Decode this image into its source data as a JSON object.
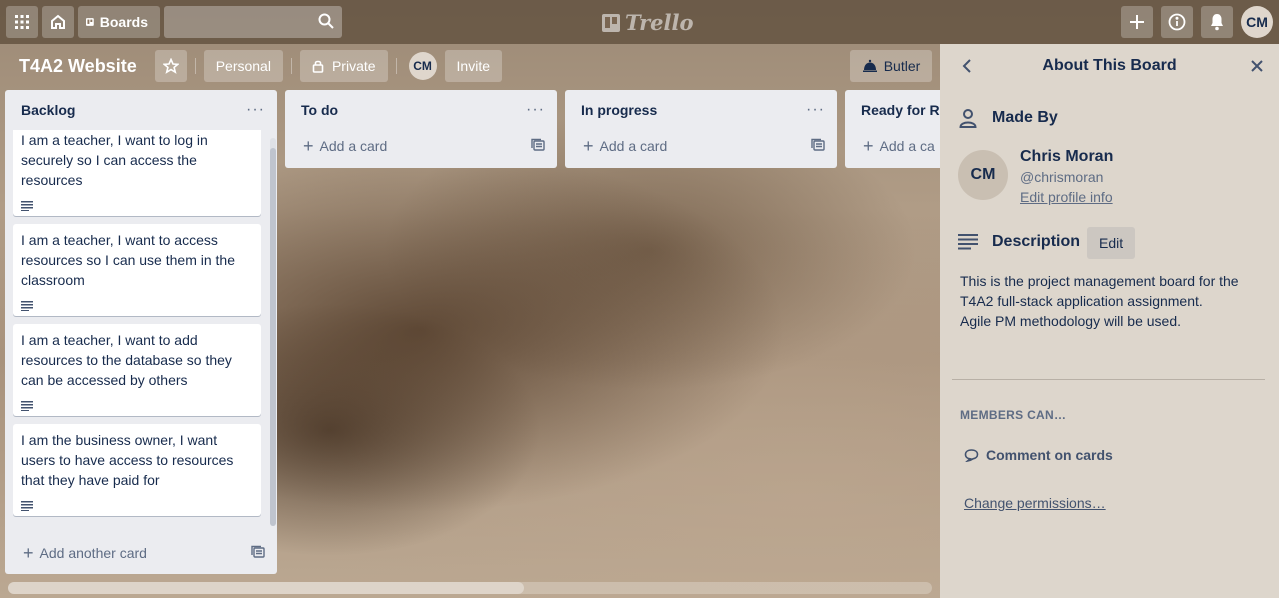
{
  "topbar": {
    "boards_label": "Boards",
    "search_placeholder": "",
    "logo_text": "Trello",
    "user_initials": "CM"
  },
  "board": {
    "title": "T4A2 Website",
    "visibility_team": "Personal",
    "visibility_privacy": "Private",
    "member_initials": "CM",
    "invite_label": "Invite",
    "butler_label": "Butler"
  },
  "lists": [
    {
      "title": "Backlog",
      "cards": [
        "I am a teacher, I want to log in securely so I can access the resources",
        "I am a teacher, I want to access resources so I can use them in the classroom",
        "I am a teacher, I want to add resources to the database so they can be accessed by others",
        "I am the business owner, I want users to have access to resources that they have paid for"
      ],
      "add_label": "Add another card"
    },
    {
      "title": "To do",
      "add_label": "Add a card"
    },
    {
      "title": "In progress",
      "add_label": "Add a card"
    },
    {
      "title": "Ready for Re",
      "add_label": "Add a ca"
    }
  ],
  "panel": {
    "title": "About This Board",
    "made_by_label": "Made By",
    "maker_initials": "CM",
    "maker_name": "Chris Moran",
    "maker_handle": "@chrismoran",
    "edit_profile_label": "Edit profile info",
    "description_label": "Description",
    "description_edit_label": "Edit",
    "description_lines": [
      "This is the project management board for the",
      "T4A2 full-stack application assignment.",
      "Agile PM methodology will be used."
    ],
    "members_can_label": "MEMBERS CAN…",
    "comment_label": "Comment on cards",
    "change_permissions_label": "Change permissions…"
  },
  "colors": {
    "topbar": "#5f4e3c",
    "list_bg": "#ebecf0",
    "panel_bg": "#ddd6cc",
    "text": "#172b4d"
  }
}
